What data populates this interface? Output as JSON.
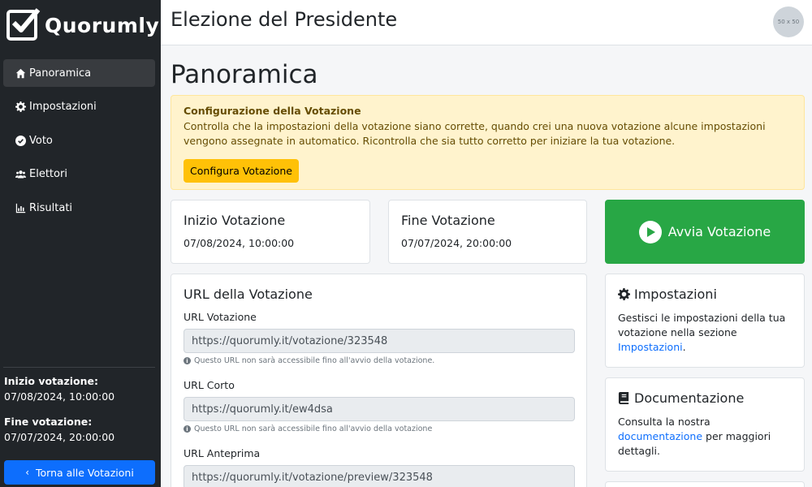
{
  "app": {
    "name": "Quorumly",
    "election_title": "Elezione del Presidente",
    "avatar_text": "50 x 50"
  },
  "sidebar": {
    "items": [
      {
        "label": "Panoramica",
        "icon": "home-icon",
        "active": true
      },
      {
        "label": "Impostazioni",
        "icon": "gear-icon",
        "active": false
      },
      {
        "label": "Voto",
        "icon": "check-circle-icon",
        "active": false
      },
      {
        "label": "Elettori",
        "icon": "users-icon",
        "active": false
      },
      {
        "label": "Risultati",
        "icon": "chart-icon",
        "active": false
      }
    ],
    "start_label": "Inizio votazione:",
    "start_value": "07/08/2024, 10:00:00",
    "end_label": "Fine votazione:",
    "end_value": "07/07/2024, 20:00:00",
    "back_label": "Torna alle Votazioni"
  },
  "main": {
    "title": "Panoramica",
    "alert": {
      "title": "Configurazione della Votazione",
      "text": "Controlla che la impostazioni della votazione siano corrette, quando crei una nuova votazione alcune impostazioni vengono assegnate in automatico. Ricontrolla che sia tutto corretto per iniziare la tua votazione.",
      "button": "Configura Votazione"
    },
    "start_card": {
      "title": "Inizio Votazione",
      "value": "07/08/2024, 10:00:00"
    },
    "end_card": {
      "title": "Fine Votazione",
      "value": "07/07/2024, 20:00:00"
    },
    "start_button": "Avvia Votazione",
    "url_card": {
      "title": "URL della Votazione",
      "fields": [
        {
          "label": "URL Votazione",
          "value": "https://quorumly.it/votazione/323548",
          "help": "Questo URL non sarà accessibile fino all'avvio della votazione."
        },
        {
          "label": "URL Corto",
          "value": "https://quorumly.it/ew4dsa",
          "help": "Questo URL non sarà accessibile fino all'avvio della votazione"
        },
        {
          "label": "URL Anteprima",
          "value": "https://quorumly.it/votazione/preview/323548"
        }
      ]
    },
    "settings_card": {
      "title": "Impostazioni",
      "text_before": "Gestisci le impostazioni della tua votazione nella sezione ",
      "link": "Impostazioni",
      "text_after": "."
    },
    "docs_card": {
      "title": "Documentazione",
      "text_before": "Consulta la nostra ",
      "link": "documentazione",
      "text_after": " per maggiori dettagli."
    }
  },
  "colors": {
    "sidebar_bg": "#212529",
    "primary": "#0d6efd",
    "success": "#28a745",
    "warning": "#ffc107",
    "alert_bg": "#fff3cd"
  }
}
